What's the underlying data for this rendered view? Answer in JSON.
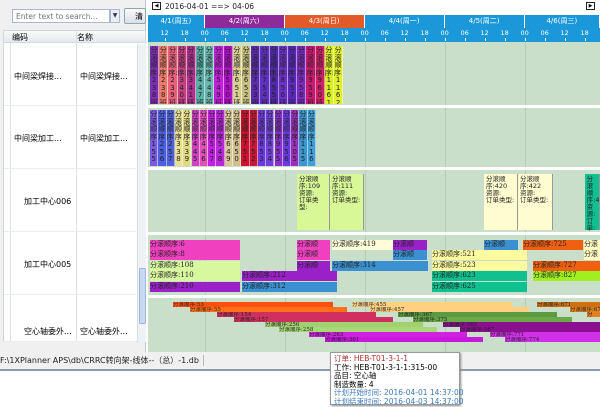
{
  "left": {
    "search_placeholder": "Enter text to search...",
    "clear_button": "清",
    "col_code": "编码",
    "col_name": "名称",
    "rows": [
      {
        "code": "中间梁焊接...",
        "name": "中间梁焊接..."
      },
      {
        "code": "中间梁加工...",
        "name": "中间梁加工..."
      },
      {
        "code": "加工中心006",
        "name": ""
      },
      {
        "code": "加工中心005",
        "name": ""
      },
      {
        "code": "空心轴委外...",
        "name": "空心轴委外..."
      }
    ]
  },
  "gantt": {
    "range": "2016-04-01 ==> 04-06",
    "days": [
      {
        "label": "4/1(周五)",
        "color": "#1a98da"
      },
      {
        "label": "4/2(周六)",
        "color": "#8e2a9a"
      },
      {
        "label": "4/3(周日)",
        "color": "#e25a2a"
      },
      {
        "label": "4/4(周一)",
        "color": "#1a98da"
      },
      {
        "label": "4/5(周二)",
        "color": "#1a98da"
      },
      {
        "label": "4/6(周三)",
        "color": "#1a98da"
      }
    ],
    "hour_labels": [
      "12",
      "18",
      "00",
      "06",
      "12",
      "18",
      "00",
      "06",
      "12",
      "18",
      "00",
      "06",
      "12",
      "18",
      "00",
      "06",
      "12",
      "18",
      "00",
      "06",
      "12",
      "18"
    ],
    "row1": [
      {
        "t": "分滚顺序:2 38 班",
        "c": "#7b2fb0"
      },
      {
        "t": "分滚顺序:2 38 班",
        "c": "#f07a6a"
      },
      {
        "t": "分滚顺序:2 39 班",
        "c": "#e8607a"
      },
      {
        "t": "分滚顺序:3 40 班",
        "c": "#c04080"
      },
      {
        "t": "分滚顺序:3 41 班",
        "c": "#b03090"
      },
      {
        "t": "分滚顺序:4 47 班",
        "c": "#5ab0a8"
      },
      {
        "t": "分滚顺序:4 48 班",
        "c": "#6ab8b0"
      },
      {
        "t": "分滚顺序:5 49 班",
        "c": "#c020d8"
      },
      {
        "t": "分滚顺序:5 50 班",
        "c": "#b010c8"
      },
      {
        "t": "分滚顺序:6 51 班",
        "c": "#d8d090"
      },
      {
        "t": "分滚顺序:6 52 班",
        "c": "#c8c080"
      },
      {
        "t": "分滚顺序:7 53 班",
        "c": "#5a2ab0"
      },
      {
        "t": "分滚顺序:7 54 班",
        "c": "#6030c0"
      },
      {
        "t": "分滚顺序:8 55 班",
        "c": "#5028a8"
      },
      {
        "t": "分滚顺序:8 56 班",
        "c": "#6a30c8"
      },
      {
        "t": "分滚顺序:9 57 班",
        "c": "#5a28b8"
      },
      {
        "t": "分滚顺序:9 58 班",
        "c": "#7a28c0"
      },
      {
        "t": "分滚顺序:9 59 班",
        "c": "#c81870"
      },
      {
        "t": "分滚顺序:9 60 班",
        "c": "#d0206a"
      },
      {
        "t": "分滚顺序:1 16 1",
        "c": "#d8f020"
      },
      {
        "t": "分滚顺序:1 16 2",
        "c": "#e0f030"
      }
    ],
    "row2": [
      {
        "t": "分滚顺序:1 5 5",
        "c": "#7a5ae0"
      },
      {
        "t": "分滚顺序:2 5 6",
        "c": "#4a60e0"
      },
      {
        "t": "分滚顺序:2 5 7",
        "c": "#5060d8"
      },
      {
        "t": "分滚顺序:3 3 8",
        "c": "#e8e090"
      },
      {
        "t": "分滚顺序:3 3 9",
        "c": "#e0d880"
      },
      {
        "t": "分滚顺序:4 4 5",
        "c": "#d040c0"
      },
      {
        "t": "分滚顺序:4 4 6",
        "c": "#e050b8"
      },
      {
        "t": "分滚顺序:5 4 7",
        "c": "#c020e0"
      },
      {
        "t": "分滚顺序:5 4 8",
        "c": "#b828d8"
      },
      {
        "t": "分滚顺序:6 4 9",
        "c": "#d8c898"
      },
      {
        "t": "分滚顺序:6 5 0",
        "c": "#d0c090"
      },
      {
        "t": "分滚顺序:7 5 1",
        "c": "#d01030"
      },
      {
        "t": "分滚顺序:7 5 2",
        "c": "#c81838"
      },
      {
        "t": "分滚顺序:8 5 3",
        "c": "#6a3ae0"
      },
      {
        "t": "分滚顺序:8 5 4",
        "c": "#7040d8"
      },
      {
        "t": "分滚顺序:9 5 5",
        "c": "#8a30c8"
      },
      {
        "t": "分滚顺序:9 5 6",
        "c": "#6a3ae0"
      },
      {
        "t": "分滚顺序:1 0 5",
        "c": "#9a30b8"
      },
      {
        "t": "分滚顺序:1 1 5",
        "c": "#3a98d0"
      },
      {
        "t": "分滚顺序:1 1 6",
        "c": "#40a0d8"
      }
    ],
    "row3": [
      {
        "t": "分滚顺序:109\n资源:\n订单类型:",
        "c": "#d8f898",
        "s": 51.7,
        "e": 61.6
      },
      {
        "t": "分滚顺序:111\n资源:\n订单类型:",
        "c": "#d8f898",
        "s": 61.6,
        "e": 71.8
      },
      {
        "t": "分滚顺序:420\n资源:\n订单类型:",
        "c": "#fffcd0",
        "s": 107.8,
        "e": 118
      },
      {
        "t": "分滚顺序:422\n资源:\n订单类型:",
        "c": "#fffcd0",
        "s": 118,
        "e": 128.5
      },
      {
        "t": "分滚顺序:4\n资源:\n订单:",
        "c": "#10c090",
        "s": 138,
        "e": 142.6
      }
    ],
    "row4": [
      {
        "l": 0,
        "s": 7.6,
        "e": 34.6,
        "c": "#f040c0",
        "t": "分滚顺序:6"
      },
      {
        "l": 0,
        "s": 51.7,
        "e": 61.6,
        "c": "#f040c0",
        "t": "分滚顺"
      },
      {
        "l": 0,
        "s": 62.2,
        "e": 80.5,
        "c": "#fffcd8",
        "t": "分滚顺序:419"
      },
      {
        "l": 0,
        "s": 80.5,
        "e": 90.7,
        "c": "#9a20c8",
        "t": "分滚顺"
      },
      {
        "l": 0,
        "s": 107.8,
        "e": 118,
        "c": "#3a90d0",
        "t": "分滚顺"
      },
      {
        "l": 0,
        "s": 119.5,
        "e": 137.5,
        "c": "#f06010",
        "t": "分滚顺序:725"
      },
      {
        "l": 0,
        "s": 137.8,
        "e": 142.6,
        "c": "#fffcc0",
        "t": "分滚"
      },
      {
        "l": 1,
        "s": 7.6,
        "e": 34.6,
        "c": "#f040c0",
        "t": "分滚顺序:8"
      },
      {
        "l": 1,
        "s": 51.7,
        "e": 61.6,
        "c": "#f040c0",
        "t": "分滚顺"
      },
      {
        "l": 1,
        "s": 80.5,
        "e": 90.7,
        "c": "#3a90d0",
        "t": "分滚顺"
      },
      {
        "l": 1,
        "s": 92.2,
        "e": 120.7,
        "c": "#fffca0",
        "t": "分滚顺序:521"
      },
      {
        "l": 1,
        "s": 137.8,
        "e": 142.6,
        "c": "#fffcc0",
        "t": "分滚"
      },
      {
        "l": 2,
        "s": 7.6,
        "e": 34.6,
        "c": "#d8f8a0",
        "t": "分滚顺序:108"
      },
      {
        "l": 2,
        "s": 51.7,
        "e": 61.6,
        "c": "#9a20c8",
        "t": "分滚顺"
      },
      {
        "l": 2,
        "s": 62.2,
        "e": 91,
        "c": "#3a90d0",
        "t": "分滚顺序:314"
      },
      {
        "l": 2,
        "s": 92.2,
        "e": 120.7,
        "c": "#fffca0",
        "t": "分滚顺序:523"
      },
      {
        "l": 2,
        "s": 122.5,
        "e": 142.6,
        "c": "#f06010",
        "t": "分滚顺序:727"
      },
      {
        "l": 3,
        "s": 7.6,
        "e": 34.6,
        "c": "#d8f8a0",
        "t": "分滚顺序:110"
      },
      {
        "l": 3,
        "s": 35.2,
        "e": 63.7,
        "c": "#9a20c8",
        "t": "分滚顺序:212"
      },
      {
        "l": 3,
        "s": 92.2,
        "e": 120.7,
        "c": "#10c090",
        "t": "分滚顺序:623"
      },
      {
        "l": 3,
        "s": 122.5,
        "e": 142.6,
        "c": "#a0f020",
        "t": "分滚顺序:827"
      },
      {
        "l": 4,
        "s": 7.6,
        "e": 34.6,
        "c": "#9a20c8",
        "t": "分滚顺序:210"
      },
      {
        "l": 4,
        "s": 35.2,
        "e": 63.7,
        "c": "#3a90d0",
        "t": "分滚顺序:312"
      },
      {
        "l": 4,
        "s": 92.2,
        "e": 120.7,
        "c": "#10c090",
        "t": "分滚顺序:625"
      }
    ],
    "row5": [
      {
        "l": 0,
        "s": 14.5,
        "e": 62.5,
        "c": "#ff5010",
        "t": "分滚顺序:53"
      },
      {
        "l": 0,
        "s": 68.2,
        "e": 116.2,
        "c": "#ffd080",
        "t": "分滚顺序:455"
      },
      {
        "l": 0,
        "s": 123.7,
        "e": 142.6,
        "c": "#d07010",
        "t": "分滚顺序:671"
      },
      {
        "l": 1,
        "s": 19.6,
        "e": 66.7,
        "c": "#ff7018",
        "t": "分滚顺序:55"
      },
      {
        "l": 1,
        "s": 73.6,
        "e": 121.3,
        "c": "#ffd080",
        "t": "分滚顺序:457"
      },
      {
        "l": 1,
        "s": 133.6,
        "e": 142.6,
        "c": "#e08020",
        "t": "分滚顺序:673"
      },
      {
        "l": 2,
        "s": 27.7,
        "e": 75.4,
        "c": "#d03060",
        "t": "分滚顺序:154"
      },
      {
        "l": 2,
        "s": 82,
        "e": 129.7,
        "c": "#5a9a40",
        "t": "分滚顺序:367"
      },
      {
        "l": 2,
        "s": 138.7,
        "e": 142.6,
        "c": "#e08020",
        "t": "分"
      },
      {
        "l": 3,
        "s": 32.8,
        "e": 80.5,
        "c": "#d03060",
        "t": "分滚顺序:157"
      },
      {
        "l": 3,
        "s": 86.5,
        "e": 134.2,
        "c": "#6aa848",
        "t": "分滚顺序:375"
      },
      {
        "l": 4,
        "s": 42.1,
        "e": 89.5,
        "c": "#a0d070",
        "t": "分滚顺序:256"
      },
      {
        "l": 4,
        "s": 95.5,
        "e": 142.6,
        "c": "#8a1090",
        "t": "分滚顺序:565"
      },
      {
        "l": 5,
        "s": 46.3,
        "e": 93.7,
        "c": "#a8d878",
        "t": "分滚顺序:258"
      },
      {
        "l": 5,
        "s": 100.6,
        "e": 142.6,
        "c": "#8a1090",
        "t": "分滚顺序:567"
      },
      {
        "l": 6,
        "s": 55.3,
        "e": 102.7,
        "c": "#d020e0",
        "t": "分滚顺序:263"
      },
      {
        "l": 6,
        "s": 109.6,
        "e": 142.6,
        "c": "#d030e8",
        "t": "分滚顺序:771"
      },
      {
        "l": 7,
        "s": 60.1,
        "e": 107.5,
        "c": "#c818e0",
        "t": "分滚顺序:361"
      },
      {
        "l": 7,
        "s": 114.1,
        "e": 142.6,
        "c": "#d030e8",
        "t": "分滚顺序:774"
      }
    ]
  },
  "status": {
    "path": "F:\\1XPlanner  APS\\db\\CRRC转向架-线体--（总）-1.db"
  },
  "tooltip": {
    "order_label": "订单:",
    "order": "HEB-T01-3-1-1",
    "work_label": "工作:",
    "work": "HEB-T01-3-1-1:315-00",
    "item_label": "品目:",
    "item": "空心轴",
    "qty_label": "制造数量:",
    "qty": "4",
    "start_label": "计划开始时间:",
    "start": "2016-04-01 14:37:00",
    "end_label": "计划结束时间:",
    "end": "2016-04-03 14:37:00"
  }
}
